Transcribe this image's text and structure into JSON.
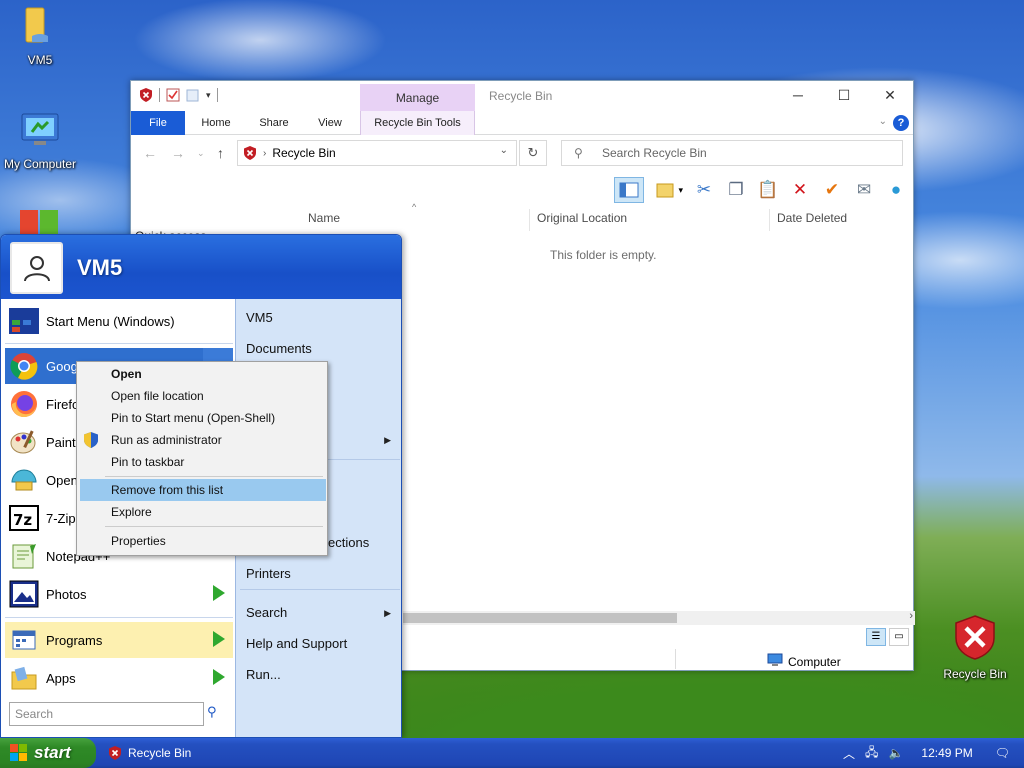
{
  "desktop": {
    "icons": [
      {
        "label": "VM5",
        "icon": "folder-icon"
      },
      {
        "label": "My Computer",
        "icon": "computer-icon"
      },
      {
        "label": "Recycle Bin",
        "icon": "recycle-bin-icon"
      }
    ]
  },
  "explorer": {
    "manage_tab": "Manage",
    "title": "Recycle Bin",
    "window_controls": [
      "─",
      "☐",
      "✕"
    ],
    "ribbon_tabs": {
      "file": "File",
      "home": "Home",
      "share": "Share",
      "view": "View",
      "tools": "Recycle Bin Tools"
    },
    "address": "Recycle Bin",
    "search_placeholder": "Search Recycle Bin",
    "columns": {
      "name": "Name",
      "original_location": "Original Location",
      "date_deleted": "Date Deleted"
    },
    "nav_pane_item": "Quick access",
    "empty_message": "This folder is empty.",
    "status_location": "Computer"
  },
  "start_menu": {
    "username": "VM5",
    "left_items": [
      {
        "label": "Start Menu (Windows)",
        "icon": "start-menu-icon"
      },
      {
        "label": "Goog",
        "icon": "chrome-icon"
      },
      {
        "label": "Firefo",
        "icon": "firefox-icon"
      },
      {
        "label": "Paint",
        "icon": "paint-icon"
      },
      {
        "label": "Open",
        "icon": "openshell-icon"
      },
      {
        "label": "7-Zip",
        "icon": "7zip-icon"
      },
      {
        "label": "Notepad++",
        "icon": "notepad-icon"
      },
      {
        "label": "Photos",
        "icon": "photos-icon"
      }
    ],
    "programs": "Programs",
    "apps": "Apps",
    "search_placeholder": "Search",
    "right_items": {
      "vm5": "VM5",
      "documents": "Documents",
      "connections": "ections",
      "printers": "Printers",
      "search": "Search",
      "help": "Help and Support",
      "run": "Run..."
    }
  },
  "context_menu": {
    "items": [
      "Open",
      "Open file location",
      "Pin to Start menu (Open-Shell)",
      "Run as administrator",
      "Pin to taskbar",
      "Remove from this list",
      "Explore",
      "Properties"
    ]
  },
  "taskbar": {
    "start_label": "start",
    "task_label": "Recycle Bin",
    "clock": "12:49 PM"
  },
  "colors": {
    "start_green": "#2f8a27",
    "taskbar_blue": "#2450c0",
    "highlight": "#99c9ef",
    "file_tab": "#1a5cd6"
  }
}
